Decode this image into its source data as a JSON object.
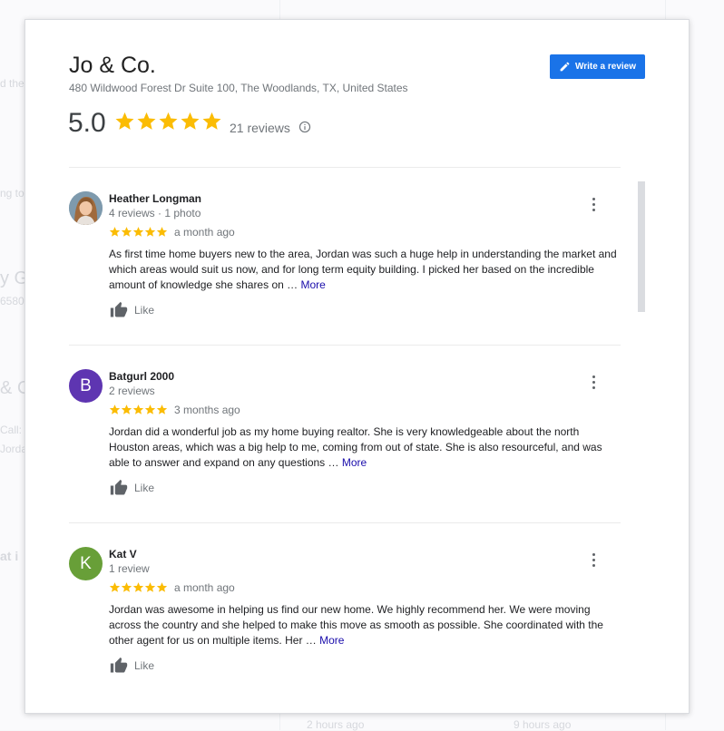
{
  "background": {
    "fragments": [
      "d the",
      "ng to",
      "y G",
      "6580",
      "& C",
      "Call:",
      "Jorda",
      "at i",
      "2 hours ago",
      "9 hours ago"
    ]
  },
  "business": {
    "name": "Jo & Co.",
    "address": "480 Wildwood Forest Dr Suite 100, The Woodlands, TX, United States",
    "rating": "5.0",
    "star_count": 5,
    "reviews_count": "21 reviews"
  },
  "write_review": {
    "label": "Write a review",
    "icon": "pencil-icon"
  },
  "info_icon": "info-icon",
  "colors": {
    "accent": "#1a73e8",
    "star": "#fbbc04",
    "link": "#1a0dab"
  },
  "reviews": [
    {
      "name": "Heather Longman",
      "meta": "4 reviews · 1 photo",
      "avatar_initial": "",
      "avatar_color": "#8aa6b8",
      "date": "a month ago",
      "text": "As first time home buyers new to the area, Jordan was such a huge help in understanding the market and which areas would suit us now, and for long term equity building. I picked her based on the incredible amount of knowledge she shares on … ",
      "more": "More",
      "like": "Like"
    },
    {
      "name": "Batgurl 2000",
      "meta": "2 reviews",
      "avatar_initial": "B",
      "avatar_color": "#5e35b1",
      "date": "3 months ago",
      "text": "Jordan did a wonderful job as my home buying realtor. She is very knowledgeable about the north Houston areas, which was a big help to me, coming from out of state. She is also resourceful, and was able to answer and expand on any questions … ",
      "more": "More",
      "like": "Like"
    },
    {
      "name": "Kat V",
      "meta": "1 review",
      "avatar_initial": "K",
      "avatar_color": "#689f38",
      "date": "a month ago",
      "text": "Jordan was awesome in helping us find our new home.  We highly recommend her.  We were moving across the country and she helped to make this move as smooth as possible.  She coordinated with the other agent for us on multiple items.  Her … ",
      "more": "More",
      "like": "Like"
    }
  ]
}
